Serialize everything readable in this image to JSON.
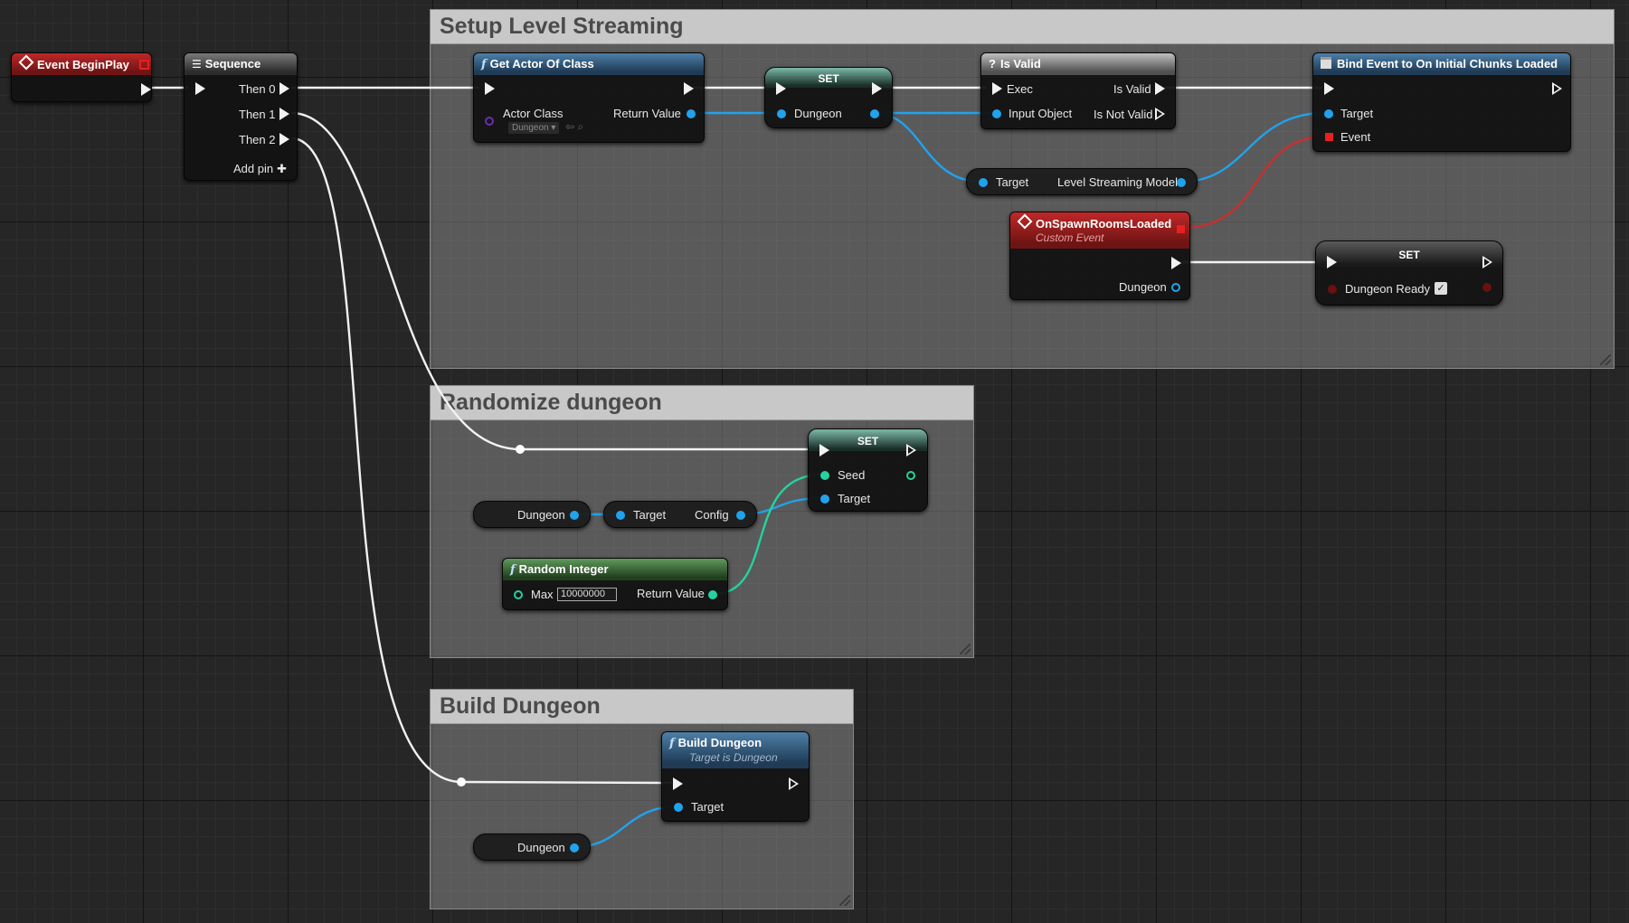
{
  "comments": {
    "setup_level_streaming": "Setup Level Streaming",
    "randomize_dungeon": "Randomize dungeon",
    "build_dungeon": "Build Dungeon"
  },
  "nodes": {
    "event_begin_play": {
      "title": "Event BeginPlay"
    },
    "sequence": {
      "title": "Sequence",
      "then0": "Then 0",
      "then1": "Then 1",
      "then2": "Then 2",
      "add_pin": "Add pin"
    },
    "get_actor_of_class": {
      "title": "Get Actor Of Class",
      "actor_class": "Actor Class",
      "actor_class_value": "Dungeon",
      "return_value": "Return Value"
    },
    "set_dungeon": {
      "title": "SET",
      "pin": "Dungeon"
    },
    "is_valid": {
      "title": "Is Valid",
      "exec": "Exec",
      "is_valid": "Is Valid",
      "input_object": "Input Object",
      "is_not_valid": "Is Not Valid"
    },
    "bind_event": {
      "title": "Bind Event to On Initial Chunks Loaded",
      "target": "Target",
      "event": "Event"
    },
    "level_streaming_getter": {
      "target": "Target",
      "output": "Level Streaming Model"
    },
    "on_spawn_rooms_loaded": {
      "title": "OnSpawnRoomsLoaded",
      "subtitle": "Custom Event",
      "dungeon": "Dungeon"
    },
    "set_dungeon_ready": {
      "title": "SET",
      "pin": "Dungeon Ready",
      "checked": "✓"
    },
    "set_seed": {
      "title": "SET",
      "seed": "Seed",
      "target": "Target"
    },
    "dungeon_var_1": {
      "label": "Dungeon"
    },
    "config_getter": {
      "target": "Target",
      "output": "Config"
    },
    "random_integer": {
      "title": "Random Integer",
      "max": "Max",
      "max_value": "10000000",
      "return_value": "Return Value"
    },
    "build_dungeon": {
      "title": "Build Dungeon",
      "subtitle": "Target is Dungeon",
      "target": "Target"
    },
    "dungeon_var_2": {
      "label": "Dungeon"
    }
  },
  "colors": {
    "exec_wire": "#f2f2f2",
    "object_wire": "#21a2ec",
    "struct_wire": "#22d3a0",
    "delegate_wire": "#e03030"
  }
}
